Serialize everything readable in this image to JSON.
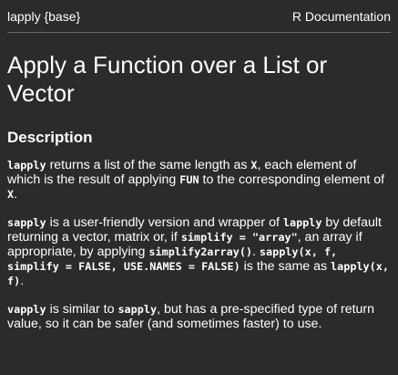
{
  "header": {
    "topic": "lapply {base}",
    "doc_source": "R Documentation"
  },
  "title": "Apply a Function over a List or Vector",
  "section": {
    "heading": "Description"
  },
  "paragraphs": {
    "p1": {
      "c1": "lapply",
      "t1": " returns a list of the same length as ",
      "c2": "X",
      "t2": ", each element of which is the result of applying ",
      "c3": "FUN",
      "t3": " to the corresponding element of ",
      "c4": "X",
      "t4": "."
    },
    "p2": {
      "c1": "sapply",
      "t1": " is a user-friendly version and wrapper of ",
      "c2": "lapply",
      "t2": " by default returning a vector, matrix or, if ",
      "c3": "simplify = \"array\"",
      "t3": ", an array if appropriate, by applying ",
      "c4": "simplify2array()",
      "t4": ". ",
      "c5": "sapply(x, f, simplify = FALSE, USE.NAMES = FALSE)",
      "t5": " is the same as ",
      "c6": "lapply(x, f)",
      "t6": "."
    },
    "p3": {
      "c1": "vapply",
      "t1": " is similar to ",
      "c2": "sapply",
      "t2": ", but has a pre-specified type of return value, so it can be safer (and sometimes faster) to use."
    }
  }
}
